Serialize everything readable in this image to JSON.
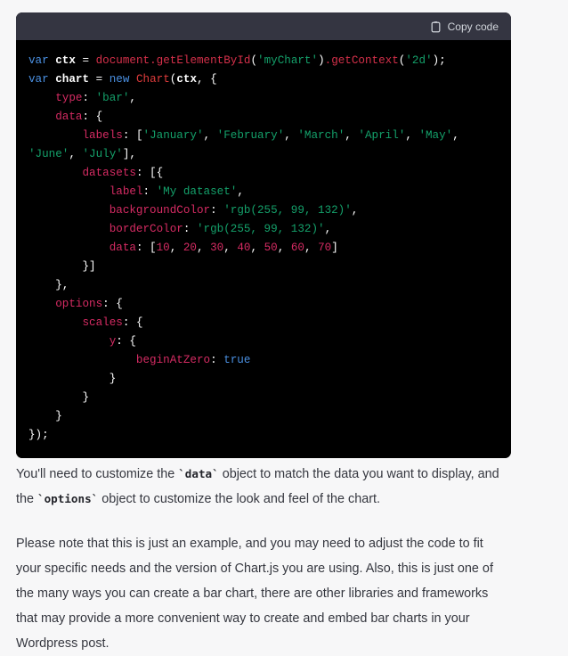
{
  "code_block": {
    "language": "javascript",
    "copy_button_label": "Copy code",
    "copy_button_icon": "clipboard-icon",
    "header_bg": "#343541",
    "body_bg": "#000000",
    "lines": [
      [
        {
          "t": "var",
          "c": "kw"
        },
        {
          "t": " ",
          "c": "pun"
        },
        {
          "t": "ctx",
          "c": "var"
        },
        {
          "t": " = ",
          "c": "pun"
        },
        {
          "t": "document",
          "c": "fn"
        },
        {
          "t": ".",
          "c": "fn"
        },
        {
          "t": "getElementById",
          "c": "fn"
        },
        {
          "t": "(",
          "c": "pun"
        },
        {
          "t": "'myChart'",
          "c": "str"
        },
        {
          "t": ")",
          "c": "pun"
        },
        {
          "t": ".",
          "c": "fn"
        },
        {
          "t": "getContext",
          "c": "fn"
        },
        {
          "t": "(",
          "c": "pun"
        },
        {
          "t": "'2d'",
          "c": "str"
        },
        {
          "t": ");",
          "c": "pun"
        }
      ],
      [
        {
          "t": "var",
          "c": "kw"
        },
        {
          "t": " ",
          "c": "pun"
        },
        {
          "t": "chart",
          "c": "var"
        },
        {
          "t": " = ",
          "c": "pun"
        },
        {
          "t": "new",
          "c": "kw"
        },
        {
          "t": " ",
          "c": "pun"
        },
        {
          "t": "Chart",
          "c": "cls"
        },
        {
          "t": "(",
          "c": "pun"
        },
        {
          "t": "ctx",
          "c": "var"
        },
        {
          "t": ", {",
          "c": "pun"
        }
      ],
      [
        {
          "t": "    ",
          "c": "pun"
        },
        {
          "t": "type",
          "c": "prop"
        },
        {
          "t": ": ",
          "c": "pun"
        },
        {
          "t": "'bar'",
          "c": "str"
        },
        {
          "t": ",",
          "c": "pun"
        }
      ],
      [
        {
          "t": "    ",
          "c": "pun"
        },
        {
          "t": "data",
          "c": "prop"
        },
        {
          "t": ": {",
          "c": "pun"
        }
      ],
      [
        {
          "t": "        ",
          "c": "pun"
        },
        {
          "t": "labels",
          "c": "prop"
        },
        {
          "t": ": [",
          "c": "pun"
        },
        {
          "t": "'January'",
          "c": "str"
        },
        {
          "t": ", ",
          "c": "pun"
        },
        {
          "t": "'February'",
          "c": "str"
        },
        {
          "t": ", ",
          "c": "pun"
        },
        {
          "t": "'March'",
          "c": "str"
        },
        {
          "t": ", ",
          "c": "pun"
        },
        {
          "t": "'April'",
          "c": "str"
        },
        {
          "t": ", ",
          "c": "pun"
        },
        {
          "t": "'May'",
          "c": "str"
        },
        {
          "t": ", ",
          "c": "pun"
        },
        {
          "t": "'June'",
          "c": "str"
        },
        {
          "t": ", ",
          "c": "pun"
        },
        {
          "t": "'July'",
          "c": "str"
        },
        {
          "t": "],",
          "c": "pun"
        }
      ],
      [
        {
          "t": "        ",
          "c": "pun"
        },
        {
          "t": "datasets",
          "c": "prop"
        },
        {
          "t": ": [{",
          "c": "pun"
        }
      ],
      [
        {
          "t": "            ",
          "c": "pun"
        },
        {
          "t": "label",
          "c": "prop"
        },
        {
          "t": ": ",
          "c": "pun"
        },
        {
          "t": "'My dataset'",
          "c": "str"
        },
        {
          "t": ",",
          "c": "pun"
        }
      ],
      [
        {
          "t": "            ",
          "c": "pun"
        },
        {
          "t": "backgroundColor",
          "c": "prop"
        },
        {
          "t": ": ",
          "c": "pun"
        },
        {
          "t": "'rgb(255, 99, 132)'",
          "c": "str"
        },
        {
          "t": ",",
          "c": "pun"
        }
      ],
      [
        {
          "t": "            ",
          "c": "pun"
        },
        {
          "t": "borderColor",
          "c": "prop"
        },
        {
          "t": ": ",
          "c": "pun"
        },
        {
          "t": "'rgb(255, 99, 132)'",
          "c": "str"
        },
        {
          "t": ",",
          "c": "pun"
        }
      ],
      [
        {
          "t": "            ",
          "c": "pun"
        },
        {
          "t": "data",
          "c": "prop"
        },
        {
          "t": ": [",
          "c": "pun"
        },
        {
          "t": "10",
          "c": "num"
        },
        {
          "t": ", ",
          "c": "pun"
        },
        {
          "t": "20",
          "c": "num"
        },
        {
          "t": ", ",
          "c": "pun"
        },
        {
          "t": "30",
          "c": "num"
        },
        {
          "t": ", ",
          "c": "pun"
        },
        {
          "t": "40",
          "c": "num"
        },
        {
          "t": ", ",
          "c": "pun"
        },
        {
          "t": "50",
          "c": "num"
        },
        {
          "t": ", ",
          "c": "pun"
        },
        {
          "t": "60",
          "c": "num"
        },
        {
          "t": ", ",
          "c": "pun"
        },
        {
          "t": "70",
          "c": "num"
        },
        {
          "t": "]",
          "c": "pun"
        }
      ],
      [
        {
          "t": "        }]",
          "c": "pun"
        }
      ],
      [
        {
          "t": "    },",
          "c": "pun"
        }
      ],
      [
        {
          "t": "    ",
          "c": "pun"
        },
        {
          "t": "options",
          "c": "prop"
        },
        {
          "t": ": {",
          "c": "pun"
        }
      ],
      [
        {
          "t": "        ",
          "c": "pun"
        },
        {
          "t": "scales",
          "c": "prop"
        },
        {
          "t": ": {",
          "c": "pun"
        }
      ],
      [
        {
          "t": "            ",
          "c": "pun"
        },
        {
          "t": "y",
          "c": "prop"
        },
        {
          "t": ": {",
          "c": "pun"
        }
      ],
      [
        {
          "t": "                ",
          "c": "pun"
        },
        {
          "t": "beginAtZero",
          "c": "prop"
        },
        {
          "t": ": ",
          "c": "pun"
        },
        {
          "t": "true",
          "c": "kw"
        }
      ],
      [
        {
          "t": "            }",
          "c": "pun"
        }
      ],
      [
        {
          "t": "        }",
          "c": "pun"
        }
      ],
      [
        {
          "t": "    }",
          "c": "pun"
        }
      ],
      [
        {
          "t": "});",
          "c": "pun"
        }
      ]
    ]
  },
  "prose": {
    "paragraphs": [
      {
        "parts": [
          {
            "t": "You'll need to customize the ",
            "code": false
          },
          {
            "t": "`data`",
            "code": true
          },
          {
            "t": " object to match the data you want to display, and the ",
            "code": false
          },
          {
            "t": "`options`",
            "code": true
          },
          {
            "t": " object to customize the look and feel of the chart.",
            "code": false
          }
        ]
      },
      {
        "parts": [
          {
            "t": "Please note that this is just an example, and you may need to adjust the code to fit your specific needs and the version of Chart.js you are using. Also, this is just one of the many ways you can create a bar chart, there are other libraries and frameworks that may provide a more convenient way to create and embed bar charts in your Wordpress post.",
            "code": false
          }
        ]
      }
    ]
  },
  "theme": {
    "page_bg": "#f7f7f8",
    "text_color": "#35373f",
    "code_header_bg": "#343541",
    "code_bg": "#000000",
    "keyword_color": "#4a90e2",
    "string_color": "#14a06a",
    "property_color": "#d62b63",
    "function_color": "#d5304a",
    "class_color": "#e03c3c"
  }
}
